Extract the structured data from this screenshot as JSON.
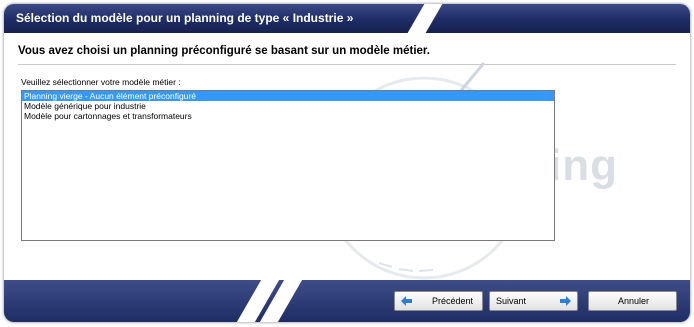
{
  "window": {
    "title": "Sélection du modèle pour un planning de type « Industrie »"
  },
  "main": {
    "heading": "Vous avez choisi un planning préconfiguré se basant sur un modèle métier.",
    "list_label": "Veuillez sélectionner votre modèle métier :",
    "models": [
      {
        "label": "Planning vierge - Aucun élément préconfiguré",
        "selected": true
      },
      {
        "label": "Modèle générique pour industrie",
        "selected": false
      },
      {
        "label": "Modèle pour cartonnages et transformateurs",
        "selected": false
      }
    ],
    "watermark_text": "ing"
  },
  "footer": {
    "previous_label": "Précédent",
    "next_label": "Suivant",
    "cancel_label": "Annuler"
  },
  "colors": {
    "title_bar": "#1e2c66",
    "selection": "#3399ff",
    "arrow": "#2a7fd4"
  },
  "icons": {
    "previous": "arrow-left-icon",
    "next": "arrow-right-icon"
  }
}
